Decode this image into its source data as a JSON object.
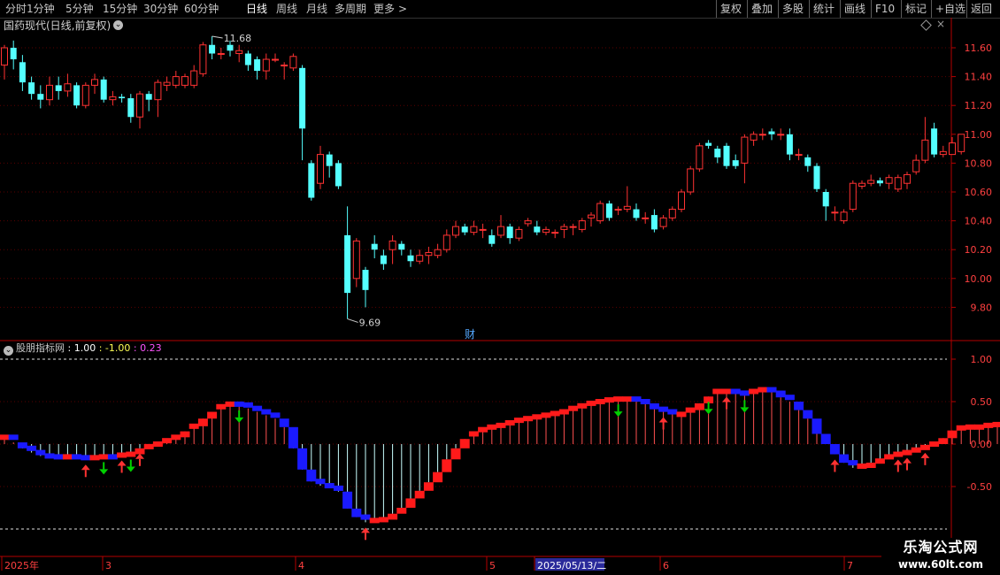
{
  "toolbar": {
    "periods": [
      "分时",
      "1分钟",
      "5分钟",
      "15分钟",
      "30分钟",
      "60分钟",
      "日线",
      "周线",
      "月线",
      "多周期",
      "更多"
    ],
    "active_period": "日线",
    "more_chevron": ">",
    "right_buttons": [
      "复权",
      "叠加",
      "多股",
      "统计",
      "画线",
      "F10",
      "标记",
      "+自选",
      "返回"
    ]
  },
  "stock": {
    "title": "国药现代(日线,前复权)",
    "high_label": "11.68",
    "low_label": "9.69",
    "event_marker": "财",
    "close_x": "×"
  },
  "indicator": {
    "name": "股朋指标网",
    "v1": ": 1.00",
    "v2": ": -1.00",
    "v3": ": 0.23"
  },
  "axis": {
    "price_ticks": [
      "11.60",
      "11.40",
      "11.20",
      "11.00",
      "10.80",
      "10.60",
      "10.40",
      "10.20",
      "10.00",
      "9.80"
    ],
    "indicator_ticks": [
      "1.00",
      "0.50",
      "0.00",
      "-0.50"
    ],
    "date_labels": [
      "2025年",
      "3",
      "4",
      "5",
      "2025/05/13/二",
      "6",
      "7"
    ]
  },
  "watermark": {
    "title": "乐淘公式网",
    "url": "www.60lt.com"
  },
  "colors": {
    "up": "#ff3232",
    "down": "#54ffff",
    "signal_up": "#ff1a1a",
    "signal_down": "#1a1aff",
    "arrow_up": "#ff3232",
    "arrow_down": "#00d000",
    "axis": "#b40000",
    "grid": "#5a0000"
  },
  "chart_data": {
    "type": "candlestick",
    "ylim": [
      9.62,
      11.74
    ],
    "candles": [
      [
        11.48,
        11.6,
        11.62,
        11.38
      ],
      [
        11.6,
        11.52,
        11.65,
        11.45
      ],
      [
        11.5,
        11.36,
        11.55,
        11.3
      ],
      [
        11.36,
        11.28,
        11.4,
        11.24
      ],
      [
        11.28,
        11.24,
        11.34,
        11.18
      ],
      [
        11.24,
        11.34,
        11.4,
        11.2
      ],
      [
        11.34,
        11.3,
        11.4,
        11.24
      ],
      [
        11.3,
        11.35,
        11.42,
        11.26
      ],
      [
        11.34,
        11.2,
        11.36,
        11.18
      ],
      [
        11.2,
        11.34,
        11.36,
        11.18
      ],
      [
        11.34,
        11.38,
        11.42,
        11.28
      ],
      [
        11.38,
        11.24,
        11.4,
        11.22
      ],
      [
        11.24,
        11.26,
        11.3,
        11.2
      ],
      [
        11.26,
        11.25,
        11.28,
        11.22
      ],
      [
        11.25,
        11.12,
        11.28,
        11.08
      ],
      [
        11.12,
        11.28,
        11.3,
        11.04
      ],
      [
        11.28,
        11.24,
        11.3,
        11.16
      ],
      [
        11.24,
        11.36,
        11.38,
        11.12
      ],
      [
        11.34,
        11.36,
        11.4,
        11.3
      ],
      [
        11.34,
        11.4,
        11.44,
        11.32
      ],
      [
        11.34,
        11.4,
        11.42,
        11.32
      ],
      [
        11.34,
        11.44,
        11.48,
        11.32
      ],
      [
        11.42,
        11.62,
        11.64,
        11.4
      ],
      [
        11.62,
        11.56,
        11.68,
        11.52
      ],
      [
        11.56,
        11.56,
        11.6,
        11.52
      ],
      [
        11.62,
        11.58,
        11.65,
        11.54
      ],
      [
        11.56,
        11.58,
        11.62,
        11.5
      ],
      [
        11.56,
        11.48,
        11.58,
        11.44
      ],
      [
        11.52,
        11.44,
        11.54,
        11.38
      ],
      [
        11.44,
        11.52,
        11.56,
        11.38
      ],
      [
        11.52,
        11.52,
        11.56,
        11.5
      ],
      [
        11.48,
        11.48,
        11.5,
        11.38
      ],
      [
        11.46,
        11.54,
        11.56,
        11.44
      ],
      [
        11.46,
        11.04,
        11.48,
        10.82
      ],
      [
        10.8,
        10.56,
        10.82,
        10.54
      ],
      [
        10.66,
        10.86,
        10.92,
        10.62
      ],
      [
        10.86,
        10.78,
        10.88,
        10.7
      ],
      [
        10.8,
        10.64,
        10.82,
        10.62
      ],
      [
        10.3,
        9.9,
        10.5,
        9.72
      ],
      [
        10.0,
        10.26,
        10.28,
        9.94
      ],
      [
        10.06,
        9.92,
        10.08,
        9.8
      ],
      [
        10.24,
        10.2,
        10.3,
        10.14
      ],
      [
        10.16,
        10.1,
        10.2,
        10.06
      ],
      [
        10.2,
        10.26,
        10.3,
        10.1
      ],
      [
        10.24,
        10.2,
        10.26,
        10.16
      ],
      [
        10.16,
        10.12,
        10.2,
        10.08
      ],
      [
        10.12,
        10.16,
        10.2,
        10.1
      ],
      [
        10.16,
        10.18,
        10.22,
        10.1
      ],
      [
        10.16,
        10.2,
        10.24,
        10.14
      ],
      [
        10.2,
        10.3,
        10.34,
        10.18
      ],
      [
        10.3,
        10.36,
        10.4,
        10.28
      ],
      [
        10.36,
        10.32,
        10.38,
        10.3
      ],
      [
        10.32,
        10.36,
        10.4,
        10.3
      ],
      [
        10.34,
        10.34,
        10.38,
        10.28
      ],
      [
        10.3,
        10.24,
        10.34,
        10.22
      ],
      [
        10.3,
        10.36,
        10.44,
        10.28
      ],
      [
        10.36,
        10.28,
        10.38,
        10.24
      ],
      [
        10.28,
        10.34,
        10.36,
        10.26
      ],
      [
        10.38,
        10.4,
        10.42,
        10.36
      ],
      [
        10.36,
        10.32,
        10.4,
        10.3
      ],
      [
        10.32,
        10.34,
        10.36,
        10.3
      ],
      [
        10.32,
        10.32,
        10.34,
        10.28
      ],
      [
        10.34,
        10.36,
        10.38,
        10.28
      ],
      [
        10.36,
        10.36,
        10.38,
        10.3
      ],
      [
        10.34,
        10.4,
        10.42,
        10.32
      ],
      [
        10.42,
        10.44,
        10.46,
        10.36
      ],
      [
        10.4,
        10.52,
        10.54,
        10.38
      ],
      [
        10.52,
        10.42,
        10.54,
        10.4
      ],
      [
        10.48,
        10.48,
        10.5,
        10.44
      ],
      [
        10.48,
        10.5,
        10.64,
        10.46
      ],
      [
        10.48,
        10.42,
        10.52,
        10.4
      ],
      [
        10.42,
        10.42,
        10.46,
        10.38
      ],
      [
        10.44,
        10.34,
        10.48,
        10.32
      ],
      [
        10.36,
        10.42,
        10.44,
        10.34
      ],
      [
        10.42,
        10.48,
        10.5,
        10.4
      ],
      [
        10.48,
        10.6,
        10.62,
        10.46
      ],
      [
        10.6,
        10.76,
        10.78,
        10.58
      ],
      [
        10.76,
        10.92,
        10.94,
        10.74
      ],
      [
        10.94,
        10.92,
        10.96,
        10.9
      ],
      [
        10.9,
        10.84,
        10.92,
        10.8
      ],
      [
        10.92,
        10.78,
        10.94,
        10.76
      ],
      [
        10.82,
        10.78,
        10.86,
        10.76
      ],
      [
        10.8,
        10.98,
        11.0,
        10.66
      ],
      [
        10.96,
        11.0,
        11.02,
        10.92
      ],
      [
        11.0,
        11.0,
        11.04,
        10.96
      ],
      [
        11.02,
        11.0,
        11.04,
        10.96
      ],
      [
        11.0,
        11.0,
        11.04,
        10.96
      ],
      [
        11.0,
        10.86,
        11.04,
        10.82
      ],
      [
        10.86,
        10.86,
        10.9,
        10.82
      ],
      [
        10.84,
        10.78,
        10.86,
        10.74
      ],
      [
        10.78,
        10.62,
        10.8,
        10.6
      ],
      [
        10.6,
        10.5,
        10.62,
        10.4
      ],
      [
        10.46,
        10.46,
        10.5,
        10.4
      ],
      [
        10.4,
        10.46,
        10.48,
        10.38
      ],
      [
        10.48,
        10.66,
        10.68,
        10.46
      ],
      [
        10.64,
        10.66,
        10.68,
        10.62
      ],
      [
        10.66,
        10.68,
        10.72,
        10.64
      ],
      [
        10.68,
        10.66,
        10.7,
        10.64
      ],
      [
        10.66,
        10.7,
        10.72,
        10.62
      ],
      [
        10.62,
        10.7,
        10.72,
        10.6
      ],
      [
        10.66,
        10.72,
        10.74,
        10.62
      ],
      [
        10.74,
        10.82,
        10.86,
        10.72
      ],
      [
        10.82,
        10.96,
        11.12,
        10.8
      ],
      [
        11.04,
        10.86,
        11.08,
        10.84
      ],
      [
        10.86,
        10.88,
        10.92,
        10.84
      ],
      [
        10.86,
        10.94,
        10.98,
        10.86
      ],
      [
        10.88,
        11.0,
        11.0,
        10.86
      ]
    ],
    "signal": [
      0.08,
      0.02,
      -0.05,
      -0.1,
      -0.14,
      -0.15,
      -0.16,
      -0.15,
      -0.16,
      -0.18,
      -0.16,
      -0.15,
      -0.16,
      -0.13,
      -0.12,
      -0.05,
      -0.03,
      0.0,
      0.04,
      0.08,
      0.15,
      0.21,
      0.3,
      0.38,
      0.44,
      0.47,
      0.46,
      0.42,
      0.38,
      0.34,
      0.3,
      0.2,
      -0.05,
      -0.3,
      -0.44,
      -0.49,
      -0.52,
      -0.56,
      -0.76,
      -0.86,
      -0.92,
      -0.9,
      -0.89,
      -0.82,
      -0.75,
      -0.64,
      -0.55,
      -0.45,
      -0.33,
      -0.18,
      -0.05,
      0.06,
      0.12,
      0.17,
      0.2,
      0.22,
      0.25,
      0.28,
      0.3,
      0.32,
      0.34,
      0.36,
      0.38,
      0.42,
      0.45,
      0.48,
      0.5,
      0.52,
      0.53,
      0.53,
      0.5,
      0.48,
      0.41,
      0.38,
      0.35,
      0.35,
      0.4,
      0.48,
      0.56,
      0.62,
      0.62,
      0.6,
      0.58,
      0.62,
      0.64,
      0.63,
      0.55,
      0.5,
      0.4,
      0.3,
      0.12,
      0.0,
      -0.12,
      -0.22,
      -0.28,
      -0.26,
      -0.25,
      -0.2,
      -0.15,
      -0.12,
      -0.1,
      -0.07,
      -0.04,
      0.0,
      0.07,
      0.16,
      0.19,
      0.2,
      0.2,
      0.22,
      0.23
    ],
    "up_arrows": [
      9,
      13,
      15,
      40,
      73,
      80,
      92,
      99,
      100,
      102
    ],
    "down_arrows": [
      11,
      14,
      26,
      68,
      78,
      82
    ],
    "signal_upper": 1.0,
    "signal_lower": -1.0,
    "signal_ylim": [
      -1.15,
      1.15
    ]
  }
}
